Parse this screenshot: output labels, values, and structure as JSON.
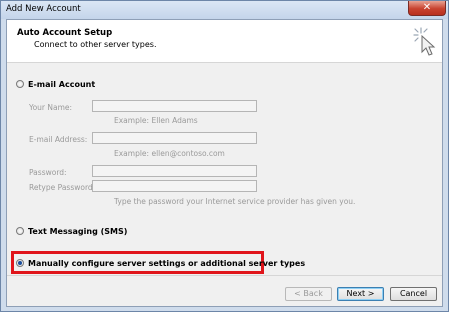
{
  "window": {
    "title": "Add New Account",
    "close_label": "✕"
  },
  "header": {
    "title": "Auto Account Setup",
    "subtitle": "Connect to other server types."
  },
  "options": {
    "email_account": "E-mail Account",
    "text_messaging": "Text Messaging (SMS)",
    "manual": "Manually configure server settings or additional server types"
  },
  "fields": {
    "your_name": {
      "label": "Your Name:",
      "value": "",
      "hint": "Example: Ellen Adams"
    },
    "email_address": {
      "label": "E-mail Address:",
      "value": "",
      "hint": "Example: ellen@contoso.com"
    },
    "password": {
      "label": "Password:",
      "value": ""
    },
    "retype_password": {
      "label": "Retype Password:",
      "value": ""
    },
    "password_hint": "Type the password your Internet service provider has given you."
  },
  "buttons": {
    "back": "< Back",
    "next": "Next >",
    "cancel": "Cancel"
  },
  "selected_option": "manual",
  "colors": {
    "highlight": "#e0151b",
    "accent": "#1a4e9c"
  },
  "icons": {
    "wizard": "cursor-sparkle-icon",
    "close": "close-icon"
  }
}
